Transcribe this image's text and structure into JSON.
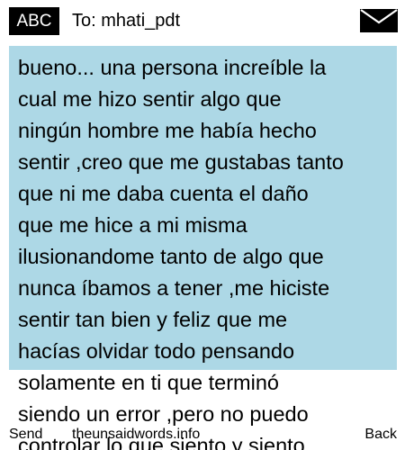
{
  "header": {
    "mode_label": "ABC",
    "recipient": "To: mhati_pdt",
    "envelope_icon": "envelope-icon"
  },
  "message": {
    "background": "#add8e6",
    "body": "bueno... una persona increíble la\ncual me hizo sentir algo que\nningún hombre me había hecho\nsentir ,creo que me gustabas tanto\nque ni me daba cuenta el daño\nque me hice a mi misma\nilusionandome tanto de algo que\nnunca íbamos a tener ,me hiciste\nsentir tan bien y feliz que me\nhacías olvidar todo pensando\nsolamente en ti que terminó\nsiendo un error ,pero no puedo\ncontrolar lo que siento y siento"
  },
  "softkeys": {
    "left": "Send",
    "center": "theunsaidwords.info",
    "right": "Back"
  }
}
